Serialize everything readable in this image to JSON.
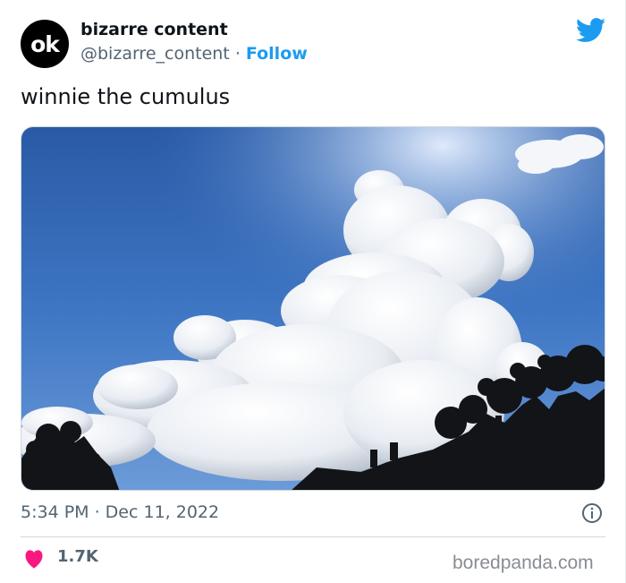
{
  "author": {
    "avatar_text": "ok",
    "display_name": "bizarre content",
    "handle": "@bizarre_content",
    "separator": "·",
    "follow_label": "Follow"
  },
  "tweet": {
    "text": "winnie the cumulus",
    "timestamp": "5:34 PM · Dec 11, 2022",
    "like_count": "1.7K"
  },
  "icons": {
    "brand": "twitter-bird-icon",
    "info": "info-icon",
    "like": "heart-icon"
  },
  "colors": {
    "accent": "#1d9bf0",
    "like": "#f91880",
    "text_primary": "#0f1419",
    "text_secondary": "#536471"
  },
  "watermark": "boredpanda.com"
}
